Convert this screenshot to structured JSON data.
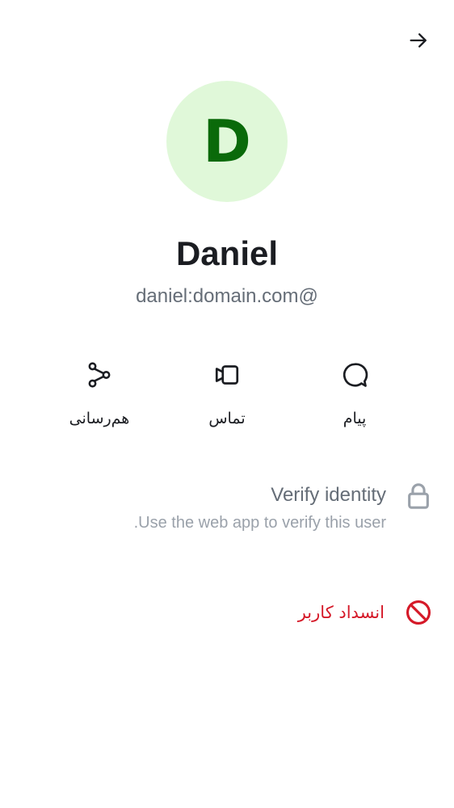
{
  "header": {
    "back_icon": "arrow-right-icon"
  },
  "profile": {
    "avatar_initial": "D",
    "avatar_bg": "#e0f8d9",
    "avatar_fg": "#0a6a0a",
    "display_name": "Daniel",
    "user_id": "@daniel:domain.com"
  },
  "actions": [
    {
      "label": "هم‌رسانی",
      "icon": "share-icon"
    },
    {
      "label": "تماس",
      "icon": "video-call-icon"
    },
    {
      "label": "پیام",
      "icon": "message-icon"
    }
  ],
  "verify": {
    "title": "Verify identity",
    "description": "Use the web app to verify this user.",
    "icon": "lock-icon"
  },
  "block": {
    "label": "انسداد کاربر",
    "icon": "block-icon",
    "color": "#d51928"
  }
}
